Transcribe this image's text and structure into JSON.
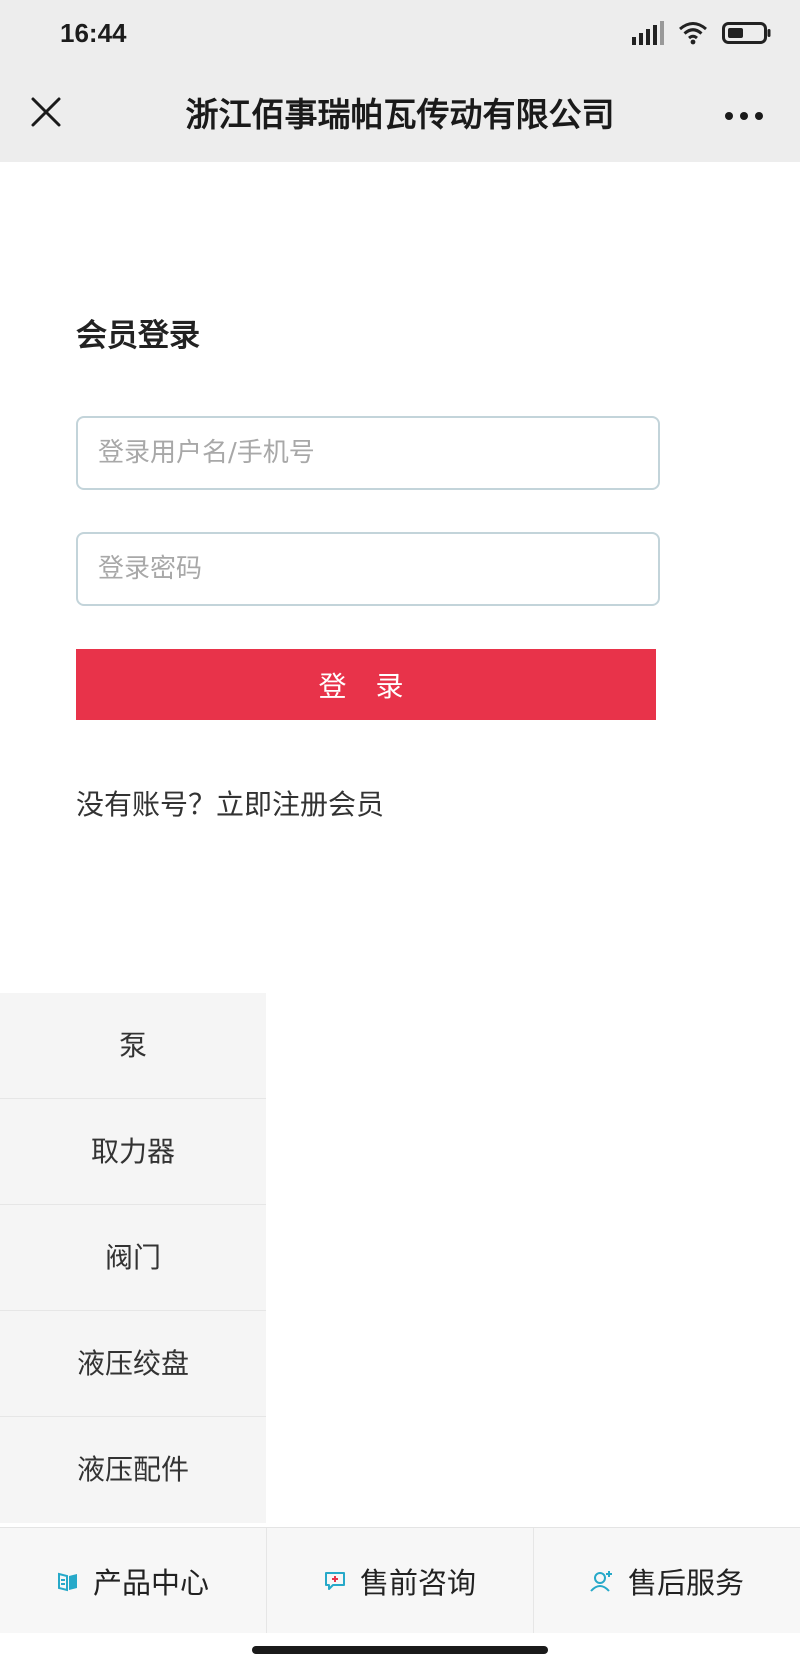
{
  "status_bar": {
    "time": "16:44"
  },
  "nav": {
    "title": "浙江佰事瑞帕瓦传动有限公司",
    "close_icon": "close-icon",
    "more_icon": "more-icon"
  },
  "login": {
    "heading": "会员登录",
    "username_placeholder": "登录用户名/手机号",
    "password_placeholder": "登录密码",
    "submit_label": "登 录",
    "register_text": "没有账号？立即注册会员"
  },
  "categories": [
    {
      "label": "泵"
    },
    {
      "label": "取力器"
    },
    {
      "label": "阀门"
    },
    {
      "label": "液压绞盘"
    },
    {
      "label": "液压配件"
    }
  ],
  "tabs": [
    {
      "label": "产品中心",
      "icon": "product-center-icon"
    },
    {
      "label": "售前咨询",
      "icon": "chat-icon"
    },
    {
      "label": "售后服务",
      "icon": "support-icon"
    }
  ],
  "colors": {
    "accent": "#e8334a",
    "tab_icon": "#27a9c9",
    "header_bg": "#ededed"
  }
}
